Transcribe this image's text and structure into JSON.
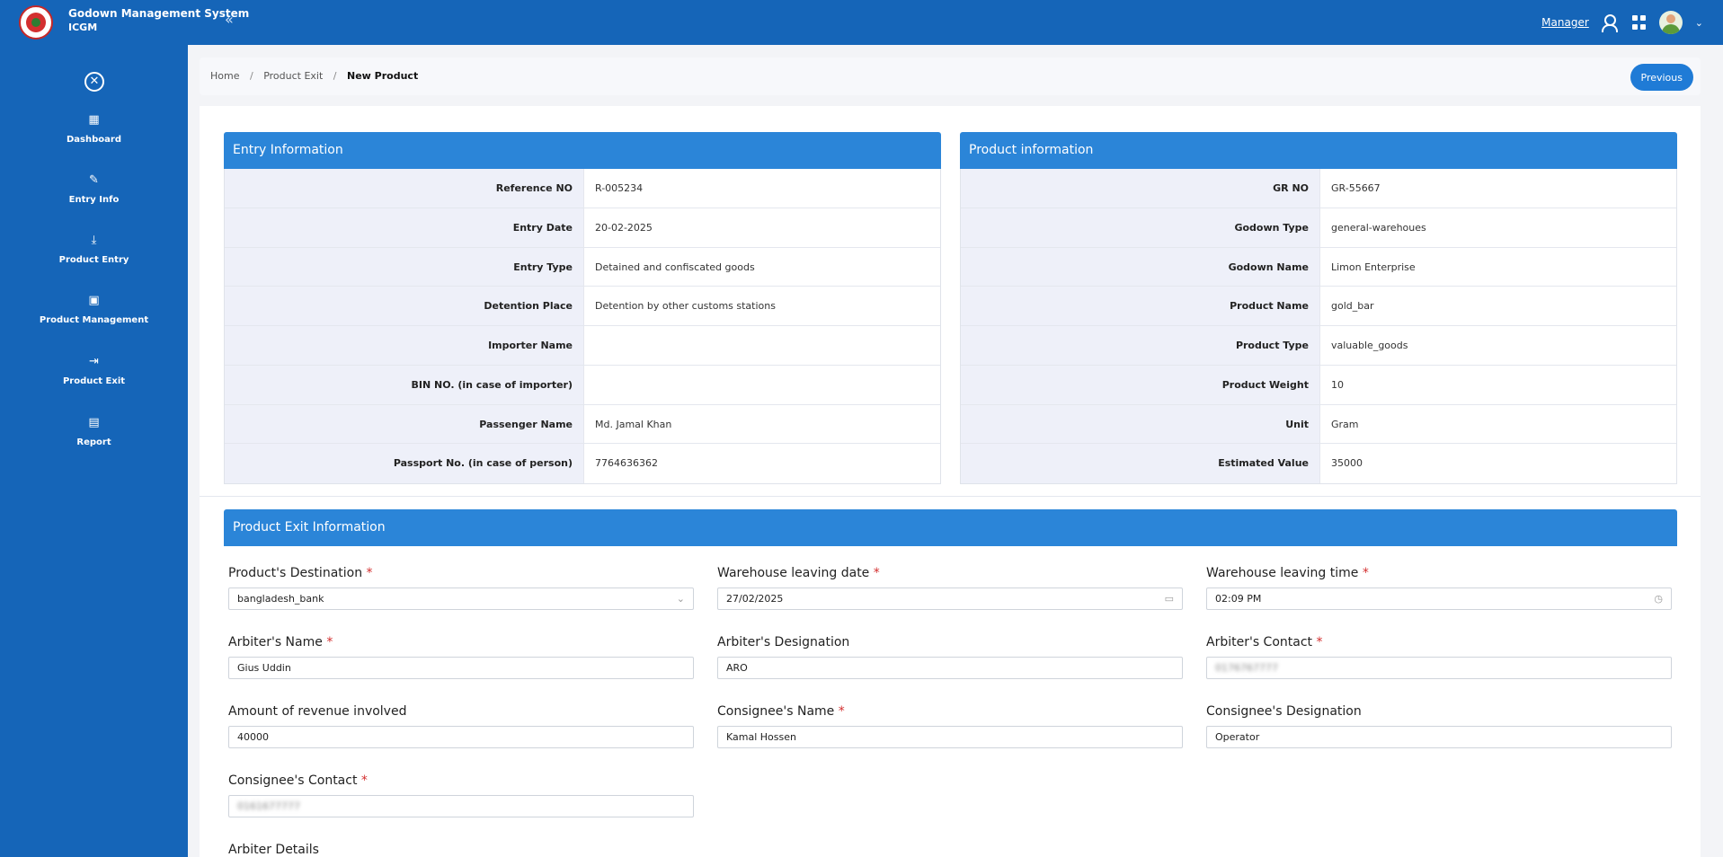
{
  "header": {
    "app_title": "Godown Management System",
    "app_subtitle": "ICGM",
    "role": "Manager"
  },
  "sidebar": {
    "items": [
      {
        "label": "Dashboard",
        "icon": "dashboard-icon"
      },
      {
        "label": "Entry Info",
        "icon": "edit-icon"
      },
      {
        "label": "Product Entry",
        "icon": "download-icon"
      },
      {
        "label": "Product Management",
        "icon": "book-icon"
      },
      {
        "label": "Product Exit",
        "icon": "exit-icon"
      },
      {
        "label": "Report",
        "icon": "report-icon"
      }
    ]
  },
  "breadcrumb": {
    "home": "Home",
    "section": "Product Exit",
    "current": "New Product",
    "previous_button": "Previous"
  },
  "entry_info": {
    "title": "Entry Information",
    "rows": [
      {
        "label": "Reference NO",
        "value": "R-005234"
      },
      {
        "label": "Entry Date",
        "value": "20-02-2025"
      },
      {
        "label": "Entry Type",
        "value": "Detained and confiscated goods"
      },
      {
        "label": "Detention Place",
        "value": "Detention by other customs stations"
      },
      {
        "label": "Importer Name",
        "value": ""
      },
      {
        "label": "BIN NO. (in case of importer)",
        "value": ""
      },
      {
        "label": "Passenger Name",
        "value": "Md. Jamal Khan"
      },
      {
        "label": "Passport No. (in case of person)",
        "value": "7764636362"
      }
    ]
  },
  "product_info": {
    "title": "Product information",
    "rows": [
      {
        "label": "GR NO",
        "value": "GR-55667"
      },
      {
        "label": "Godown Type",
        "value": "general-warehoues"
      },
      {
        "label": "Godown Name",
        "value": "Limon Enterprise"
      },
      {
        "label": "Product Name",
        "value": "gold_bar"
      },
      {
        "label": "Product Type",
        "value": "valuable_goods"
      },
      {
        "label": "Product Weight",
        "value": "10"
      },
      {
        "label": "Unit",
        "value": "Gram"
      },
      {
        "label": "Estimated Value",
        "value": "35000"
      }
    ]
  },
  "exit_form": {
    "title": "Product Exit Information",
    "destination": {
      "label": "Product's Destination",
      "value": "bangladesh_bank"
    },
    "leaving_date": {
      "label": "Warehouse leaving date",
      "value": "27/02/2025"
    },
    "leaving_time": {
      "label": "Warehouse leaving time",
      "value": "02:09 PM"
    },
    "arbiter_name": {
      "label": "Arbiter's Name",
      "value": "Gius Uddin"
    },
    "arbiter_designation": {
      "label": "Arbiter's Designation",
      "value": "ARO"
    },
    "arbiter_contact": {
      "label": "Arbiter's Contact",
      "value": "0176767777"
    },
    "revenue": {
      "label": "Amount of revenue involved",
      "value": "40000"
    },
    "consignee_name": {
      "label": "Consignee's Name",
      "value": "Kamal Hossen"
    },
    "consignee_designation": {
      "label": "Consignee's Designation",
      "value": "Operator"
    },
    "consignee_contact": {
      "label": "Consignee's Contact",
      "value": "0161677777"
    },
    "arbiter_details_label": "Arbiter Details"
  }
}
